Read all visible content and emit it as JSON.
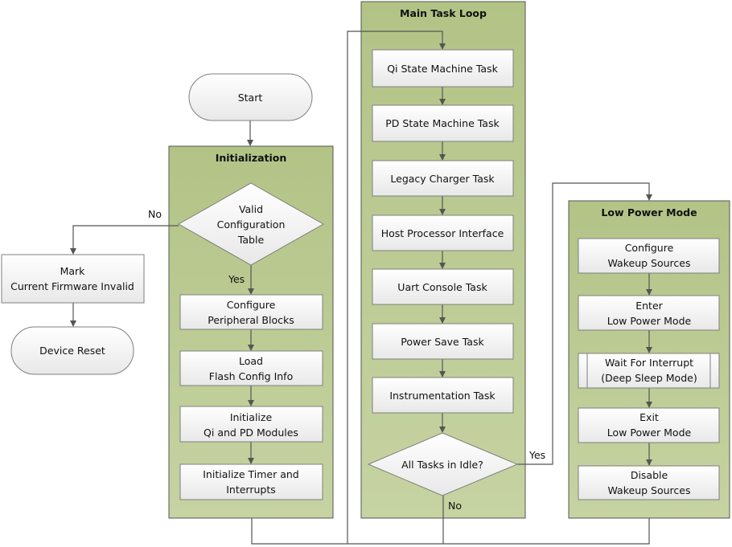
{
  "start": "Start",
  "initialization": {
    "title": "Initialization",
    "decision": [
      "Valid",
      "Configuration",
      "Table"
    ],
    "yes": "Yes",
    "no": "No",
    "steps": [
      [
        "Configure",
        "Peripheral Blocks"
      ],
      [
        "Load",
        "Flash Config Info"
      ],
      [
        "Initialize",
        "Qi and PD Modules"
      ],
      [
        "Initialize Timer and",
        "Interrupts"
      ]
    ]
  },
  "invalid": {
    "mark": [
      "Mark",
      "Current Firmware Invalid"
    ],
    "reset": "Device Reset"
  },
  "main_loop": {
    "title": "Main Task Loop",
    "tasks": [
      "Qi State Machine Task",
      "PD State Machine Task",
      "Legacy Charger Task",
      "Host Processor Interface",
      "Uart Console Task",
      "Power Save Task",
      "Instrumentation Task"
    ],
    "decision": "All Tasks in Idle?",
    "yes": "Yes",
    "no": "No"
  },
  "low_power": {
    "title": "Low Power Mode",
    "steps": [
      [
        "Configure",
        "Wakeup Sources"
      ],
      [
        "Enter",
        "Low Power Mode"
      ],
      [
        "Wait For Interrupt",
        "(Deep Sleep Mode)"
      ],
      [
        "Exit",
        "Low Power Mode"
      ],
      [
        "Disable",
        "Wakeup Sources"
      ]
    ]
  },
  "colors": {
    "container": "#bccb93",
    "box": "#f2f2f2",
    "line": "#555555"
  }
}
